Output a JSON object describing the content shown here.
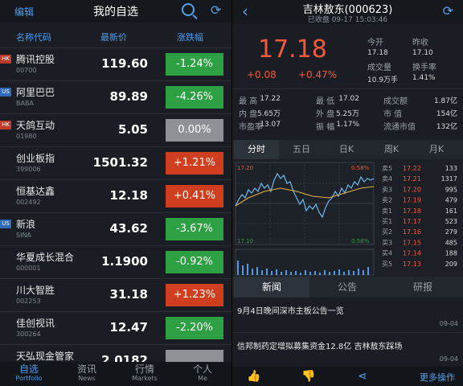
{
  "watchlist": {
    "edit_label": "编辑",
    "title": "我的自选",
    "columns": {
      "name": "名称代码",
      "price": "最新价",
      "change": "涨跌幅"
    },
    "stocks": [
      {
        "market": "HK",
        "name": "腾讯控股",
        "code": "00700",
        "price": "119.60",
        "change": "-1.24%",
        "dir": "down"
      },
      {
        "market": "US",
        "name": "阿里巴巴",
        "code": "BABA",
        "price": "89.89",
        "change": "-4.26%",
        "dir": "down"
      },
      {
        "market": "HK",
        "name": "天鸽互动",
        "code": "01980",
        "price": "5.05",
        "change": "0.00%",
        "dir": "flat"
      },
      {
        "market": "",
        "name": "创业板指",
        "code": "399006",
        "price": "1501.32",
        "change": "+1.21%",
        "dir": "up"
      },
      {
        "market": "",
        "name": "恒基达鑫",
        "code": "002492",
        "price": "12.18",
        "change": "+0.41%",
        "dir": "up"
      },
      {
        "market": "US",
        "name": "新浪",
        "code": "SINA",
        "price": "43.62",
        "change": "-3.67%",
        "dir": "down"
      },
      {
        "market": "",
        "name": "华夏成长混合",
        "code": "000001",
        "price": "1.1900",
        "change": "-0.92%",
        "dir": "down"
      },
      {
        "market": "",
        "name": "川大智胜",
        "code": "002253",
        "price": "31.18",
        "change": "+1.23%",
        "dir": "up"
      },
      {
        "market": "",
        "name": "佳创视讯",
        "code": "300264",
        "price": "12.47",
        "change": "-2.20%",
        "dir": "down"
      },
      {
        "market": "",
        "name": "天弘现金管家",
        "code": "",
        "price": "2.0182",
        "change": "",
        "dir": "flat"
      }
    ],
    "bottom_tabs": [
      {
        "label": "自选",
        "en": "Portfolio"
      },
      {
        "label": "资讯",
        "en": "News"
      },
      {
        "label": "行情",
        "en": "Markets"
      },
      {
        "label": "个人",
        "en": "Me"
      }
    ]
  },
  "detail": {
    "title": "吉林敖东(000623)",
    "subtitle": "已收盘 09-17 15:03:46",
    "price": "17.18",
    "change": "+0.08",
    "change_pct": "+0.47%",
    "quote": [
      {
        "k": "今开",
        "v": "17.18"
      },
      {
        "k": "昨收",
        "v": "17.10"
      },
      {
        "k": "成交量",
        "v": "10.9万手"
      },
      {
        "k": "换手率",
        "v": "1.41%"
      }
    ],
    "stats": [
      {
        "k": "最  高",
        "v": "17.22",
        "k2": "最  低",
        "v2": "17.02",
        "k3": "成交额",
        "v3": "1.87亿"
      },
      {
        "k": "内  盘",
        "v": "5.65万",
        "k2": "外  盘",
        "v2": "5.25万",
        "k3": "市  值",
        "v3": "154亿"
      },
      {
        "k": "市盈率",
        "v": "13.07",
        "k2": "振  幅",
        "v2": "1.17%",
        "k3": "流通市值",
        "v3": "132亿"
      }
    ],
    "chart_tabs": [
      "分时",
      "五日",
      "日K",
      "周K",
      "月K"
    ],
    "chart_labels": {
      "top": "17.20",
      "top_pct": "0.58%",
      "mid": "17.10",
      "mid_pct": "0.58%"
    },
    "order_book": {
      "asks": [
        {
          "label": "卖5",
          "price": "17.22",
          "vol": "133"
        },
        {
          "label": "卖4",
          "price": "17.21",
          "vol": "1317"
        },
        {
          "label": "卖3",
          "price": "17.20",
          "vol": "995"
        },
        {
          "label": "卖2",
          "price": "17.19",
          "vol": "479"
        },
        {
          "label": "卖1",
          "price": "17.18",
          "vol": "161"
        }
      ],
      "bids": [
        {
          "label": "买1",
          "price": "17.17",
          "vol": "523"
        },
        {
          "label": "买2",
          "price": "17.16",
          "vol": "279"
        },
        {
          "label": "买3",
          "price": "17.15",
          "vol": "485"
        },
        {
          "label": "买4",
          "price": "17.14",
          "vol": "188"
        },
        {
          "label": "买5",
          "price": "17.13",
          "vol": "209"
        }
      ]
    },
    "news_tabs": [
      "新闻",
      "公告",
      "研报"
    ],
    "news": [
      {
        "title": "9月4日晚间深市主板公告一览",
        "date": "09-04"
      },
      {
        "title": "信邦制药定增拟募集资金12.8亿 吉林敖东踩场",
        "date": "09-04"
      }
    ],
    "more_label": "更多操作",
    "colors": {
      "up": "#cf3f1f",
      "down": "#2ca043",
      "flat": "#8e9196",
      "accent": "#4f9be8"
    }
  }
}
